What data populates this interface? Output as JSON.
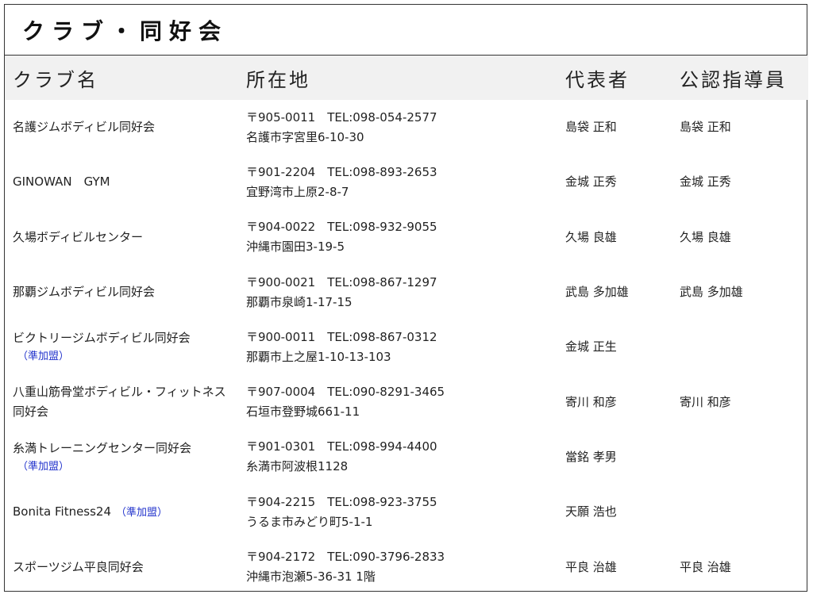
{
  "page": {
    "title": "クラブ・同好会"
  },
  "table": {
    "headers": [
      "クラブ名",
      "所在地",
      "代表者",
      "公認指導員"
    ],
    "rows": [
      {
        "name": "名護ジムボディビル同好会",
        "sub": "",
        "addr1": "〒905-0011　TEL:098-054-2577",
        "addr2": "名護市字宮里6-10-30",
        "rep": "島袋 正和",
        "coach": "島袋 正和"
      },
      {
        "name": "GINOWAN　GYM",
        "sub": "",
        "addr1": "〒901-2204　TEL:098-893-2653",
        "addr2": "宜野湾市上原2-8-7",
        "rep": "金城 正秀",
        "coach": "金城 正秀"
      },
      {
        "name": "久場ボディビルセンター",
        "sub": "",
        "addr1": "〒904-0022　TEL:098-932-9055",
        "addr2": "沖縄市園田3-19-5",
        "rep": "久場 良雄",
        "coach": "久場 良雄"
      },
      {
        "name": "那覇ジムボディビル同好会",
        "sub": "",
        "addr1": "〒900-0021　TEL:098-867-1297",
        "addr2": "那覇市泉崎1-17-15",
        "rep": "武島 多加雄",
        "coach": "武島 多加雄"
      },
      {
        "name": "ビクトリージムボディビル同好会",
        "sub": "（準加盟）",
        "addr1": "〒900-0011　TEL:098-867-0312",
        "addr2": "那覇市上之屋1-10-13-103",
        "rep": "金城 正生",
        "coach": ""
      },
      {
        "name": "八重山筋骨堂ボディビル・フィットネス同好会",
        "sub": "",
        "addr1": "〒907-0004　TEL:090-8291-3465",
        "addr2": "石垣市登野城661-11",
        "rep": "寄川 和彦",
        "coach": "寄川 和彦"
      },
      {
        "name": "糸満トレーニングセンター同好会",
        "sub": "（準加盟）",
        "addr1": "〒901-0301　TEL:098-994-4400",
        "addr2": "糸満市阿波根1128",
        "rep": "當銘 孝男",
        "coach": ""
      },
      {
        "name": "Bonita Fitness24",
        "sub": "（準加盟）",
        "addr1": "〒904-2215　TEL:098-923-3755",
        "addr2": "うるま市みどり町5-1-1",
        "rep": "天願 浩也",
        "coach": ""
      },
      {
        "name": "スポーツジム平良同好会",
        "sub": "",
        "addr1": "〒904-2172　TEL:090-3796-2833",
        "addr2": "沖縄市泡瀬5-36-31 1階",
        "rep": "平良 治雄",
        "coach": "平良 治雄"
      }
    ]
  }
}
